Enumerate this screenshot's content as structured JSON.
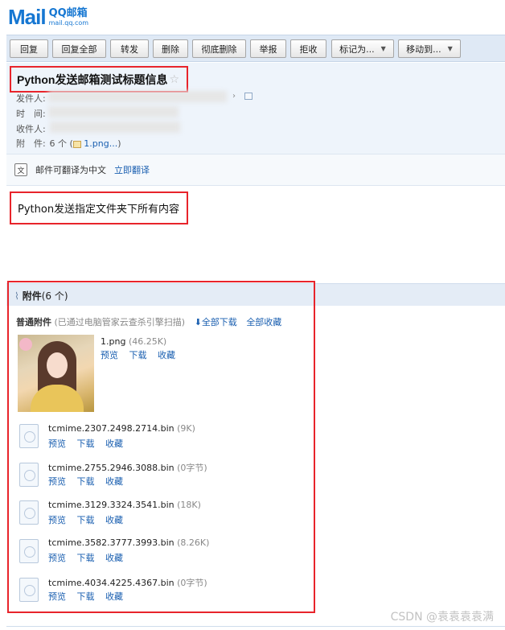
{
  "logo": {
    "main": "Mail",
    "sub_top": "QQ邮箱",
    "sub_bottom": "mail.qq.com"
  },
  "toolbar": {
    "reply": "回复",
    "reply_all": "回复全部",
    "forward": "转发",
    "delete": "删除",
    "delete_forever": "彻底删除",
    "report": "举报",
    "reject": "拒收",
    "mark_as": "标记为...",
    "move_to": "移动到..."
  },
  "mail": {
    "subject": "Python发送邮箱测试标题信息",
    "from_label": "发件人:",
    "time_label": "时　间:",
    "to_label": "收件人:",
    "attach_label": "附　件:",
    "attach_count": "6 个",
    "attach_preview": "1.png..."
  },
  "translate": {
    "text": "邮件可翻译为中文",
    "link": "立即翻译"
  },
  "content": {
    "text": "Python发送指定文件夹下所有内容"
  },
  "attachments": {
    "title": "附件",
    "count": "(6 个)",
    "normal_label": "普通附件",
    "scan_note": "(已通过电脑管家云查杀引擎扫描)",
    "download_all": "全部下载",
    "collect_all": "全部收藏",
    "action_preview": "预览",
    "action_download": "下载",
    "action_collect": "收藏",
    "files": [
      {
        "name": "1.png",
        "size": "(46.25K)"
      },
      {
        "name": "tcmime.2307.2498.2714.bin",
        "size": "(9K)"
      },
      {
        "name": "tcmime.2755.2946.3088.bin",
        "size": "(0字节)"
      },
      {
        "name": "tcmime.3129.3324.3541.bin",
        "size": "(18K)"
      },
      {
        "name": "tcmime.3582.3777.3993.bin",
        "size": "(8.26K)"
      },
      {
        "name": "tcmime.4034.4225.4367.bin",
        "size": "(0字节)"
      }
    ]
  },
  "watermark": "CSDN @袁袁袁袁满"
}
